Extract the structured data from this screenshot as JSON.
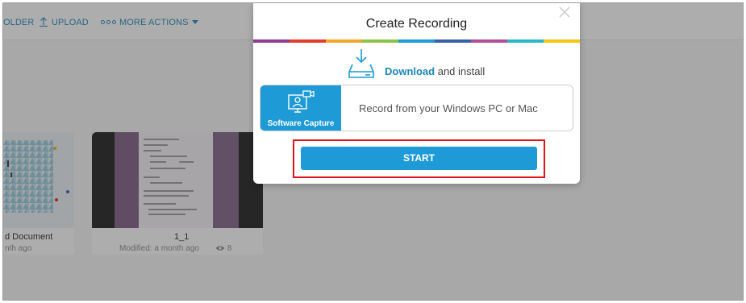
{
  "toolbar": {
    "folder_label": "OLDER",
    "upload_label": "UPLOAD",
    "more_actions_label": "MORE ACTIONS"
  },
  "cards": [
    {
      "title": "d Document",
      "meta": "nth ago",
      "views": ""
    },
    {
      "title": "1_1",
      "meta": "Modified: a month ago",
      "views": "8"
    }
  ],
  "modal": {
    "title": "Create Recording",
    "download": {
      "link": "Download",
      "suffix": " and install"
    },
    "software_capture": {
      "tile_label": "Software Capture",
      "description": "Record from your Windows PC or Mac"
    },
    "start_label": "START"
  },
  "colors": {
    "accent": "#1e9ad6",
    "link": "#1a86b8",
    "highlight": "#e0141b",
    "rainbow": [
      "#8e3b8f",
      "#e23c2f",
      "#f0a826",
      "#8bc34a",
      "#1e9ad6",
      "#3b5ea8",
      "#b44d9a",
      "#26b7c9",
      "#f5c518"
    ]
  }
}
